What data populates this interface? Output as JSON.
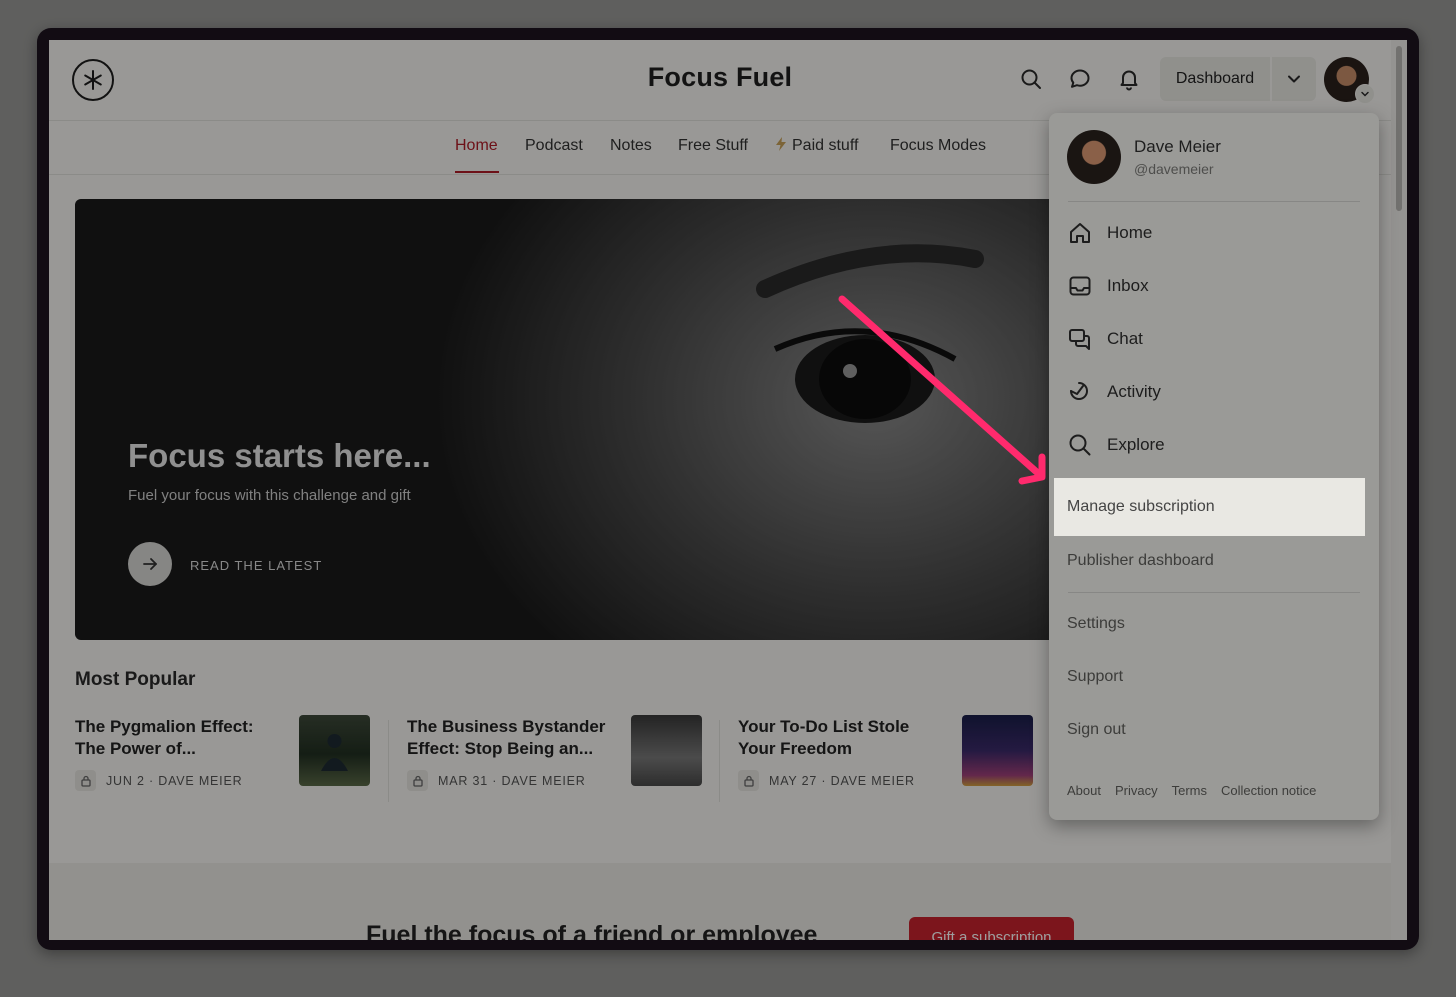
{
  "header": {
    "site_title": "Focus Fuel",
    "dashboard_label": "Dashboard"
  },
  "nav": {
    "tabs": [
      {
        "label": "Home",
        "active": true
      },
      {
        "label": "Podcast"
      },
      {
        "label": "Notes"
      },
      {
        "label": "Free Stuff"
      },
      {
        "label": "Paid stuff",
        "icon": "lightning-icon"
      },
      {
        "label": "Focus Modes"
      }
    ]
  },
  "hero": {
    "title": "Focus starts here...",
    "subtitle": "Fuel your focus with this challenge and gift",
    "cta": "READ THE LATEST"
  },
  "most_popular": {
    "title": "Most Popular",
    "posts": [
      {
        "title": "The Pygmalion Effect: The Power of...",
        "meta": "JUN 2 · DAVE MEIER"
      },
      {
        "title": "The Business Bystander Effect: Stop Being an...",
        "meta": "MAR 31 · DAVE MEIER"
      },
      {
        "title": "Your To-Do List Stole Your Freedom",
        "meta": "MAY 27 · DAVE MEIER"
      }
    ]
  },
  "band": {
    "text": "Fuel the focus of a friend or employee",
    "gift_button": "Gift a subscription"
  },
  "menu": {
    "user_name": "Dave Meier",
    "user_handle": "@davemeier",
    "items": [
      {
        "label": "Home",
        "icon": "home-icon"
      },
      {
        "label": "Inbox",
        "icon": "inbox-icon"
      },
      {
        "label": "Chat",
        "icon": "chat-icon"
      },
      {
        "label": "Activity",
        "icon": "activity-icon"
      },
      {
        "label": "Explore",
        "icon": "search-icon"
      }
    ],
    "manage_subscription": "Manage subscription",
    "publisher_dashboard": "Publisher dashboard",
    "settings": "Settings",
    "support": "Support",
    "sign_out": "Sign out",
    "footer": [
      "About",
      "Privacy",
      "Terms",
      "Collection notice"
    ]
  },
  "colors": {
    "accent": "#b01c27",
    "annotation_arrow": "#ff2a6d"
  }
}
